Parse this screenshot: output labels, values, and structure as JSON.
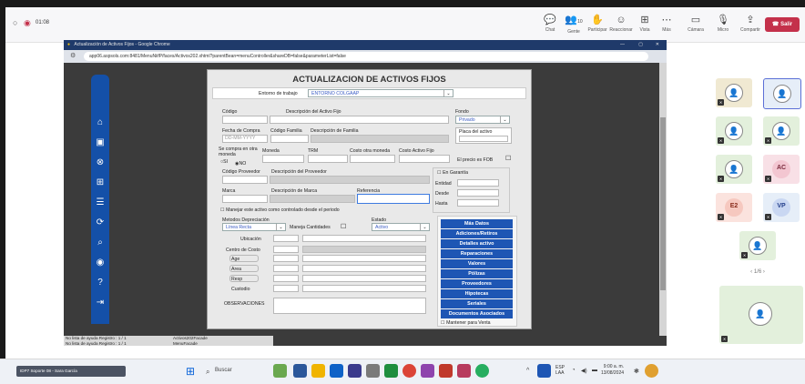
{
  "meeting": {
    "timer": "01:08",
    "toolbar": [
      {
        "label": "Chat",
        "icon": "chat-icon",
        "glyph": "💬"
      },
      {
        "label": "Gente",
        "count": "10",
        "icon": "people-icon",
        "glyph": "👥"
      },
      {
        "label": "Participar",
        "icon": "raise-hand-icon",
        "glyph": "✋"
      },
      {
        "label": "Reaccionar",
        "icon": "reaction-icon",
        "glyph": "☺"
      },
      {
        "label": "Vista",
        "icon": "view-icon",
        "glyph": "⊞"
      },
      {
        "label": "Más",
        "icon": "more-icon",
        "glyph": "⋯"
      },
      {
        "label": "Cámara",
        "icon": "camera-icon",
        "glyph": "▭"
      },
      {
        "label": "Micro",
        "icon": "mic-icon",
        "glyph": "🎙"
      },
      {
        "label": "Compartir",
        "icon": "share-icon",
        "glyph": "⇪"
      }
    ],
    "leave_label": "Salir",
    "participants": [
      {
        "initials": "",
        "bg": "#f0e9d2"
      },
      {
        "initials": "",
        "bg": "#e6eef8"
      },
      {
        "initials": "",
        "bg": "#e3f0dc"
      },
      {
        "initials": "",
        "bg": "#e3f0dc"
      },
      {
        "initials": "",
        "bg": "#e3f0dc"
      },
      {
        "initials": "AC",
        "bg": "#f8e0e6"
      },
      {
        "initials": "E2",
        "bg": "#fbe3de"
      },
      {
        "initials": "VP",
        "bg": "#e6eef8"
      },
      {
        "initials": "",
        "bg": "#e3f0dc"
      }
    ],
    "pager": "1/6",
    "self_tile_bg": "#e3f0dc"
  },
  "shared": {
    "window_title": "Actualización de Activos Fijos - Google Chrome",
    "url": "app06.aspsols.com:8481/MenuNiifP/faces/Activos202.xhtml?parentBean=menuController&shareDB=false&parameterList=false",
    "status_left": "No lista de ayuda   Registro : 1 / 1",
    "status_right": "Activos202Facade",
    "status_left2": "No lista de ayuda   Registro : 1 / 1",
    "status_right2": "MenuFacade"
  },
  "form": {
    "title": "ACTUALIZACION DE ACTIVOS FIJOS",
    "entorno_label": "Entorno de trabajo",
    "entorno_value": "ENTORNO COLGAAP",
    "codigo_label": "Código",
    "descripcion_label": "Descripción del Activo Fijo",
    "fondo_label": "Fondo",
    "fondo_value": "Privado",
    "fecha_compra_label": "Fecha de Compra",
    "fecha_placeholder": "DD-MM-YYYY",
    "codigo_familia_label": "Código Familia",
    "descripcion_familia_label": "Descripción de Familia",
    "placa_label": "Placa del activo",
    "compra_otra_moneda_label": "Se compra en otra moneda",
    "si_label": "SI",
    "no_label": "NO",
    "moneda_label": "Moneda",
    "trm_label": "TRM",
    "costo_otra_moneda_label": "Costo otra moneda",
    "costo_activo_label": "Costo Activo Fijo",
    "precio_fob_label": "El precio es FOB",
    "codigo_proveedor_label": "Código Proveedor",
    "descripcion_proveedor_label": "Descripción del Proveedor",
    "garantia_label": "En Garantía",
    "entidad_label": "Entidad",
    "desde_label": "Desde",
    "hasta_label": "Hasta",
    "marca_label": "Marca",
    "descripcion_marca_label": "Descripción de Marca",
    "referencia_label": "Referencia",
    "controlado_label": "Manejar este activo como controlado desde el periodo",
    "metodos_label": "Metodos Depreciación",
    "metodo_value": "Línea Recta",
    "maneja_cantidades_label": "Maneja Cantidades",
    "estado_label": "Estado",
    "estado_value": "Activo",
    "ubicacion_label": "Ubicación",
    "centro_costo_label": "Centro de Costo",
    "age_label": "Age",
    "area_label": "Area",
    "resp_label": "Resp",
    "custodio_label": "Custodio",
    "observaciones_label": "OBSERVACIONES",
    "buttons": [
      "Más Datos",
      "Adiciones/Retiros",
      "Detalles activo",
      "Reparaciones",
      "Valores",
      "Pólizas",
      "Proveedores",
      "Hipotecas",
      "Seriales",
      "Documentos Asociados"
    ],
    "mantener_label": "Mantener para Venta"
  },
  "taskbar": {
    "meeting_chip": "IDP7 Soporte 08 - Sara García",
    "search_placeholder": "Buscar",
    "lang": "ESP",
    "lang2": "LAA",
    "time": "9:00 a. m.",
    "date": "13/08/2024"
  },
  "colors": {
    "accent_blue": "#1e56b4",
    "leave_red": "#c4314b"
  }
}
